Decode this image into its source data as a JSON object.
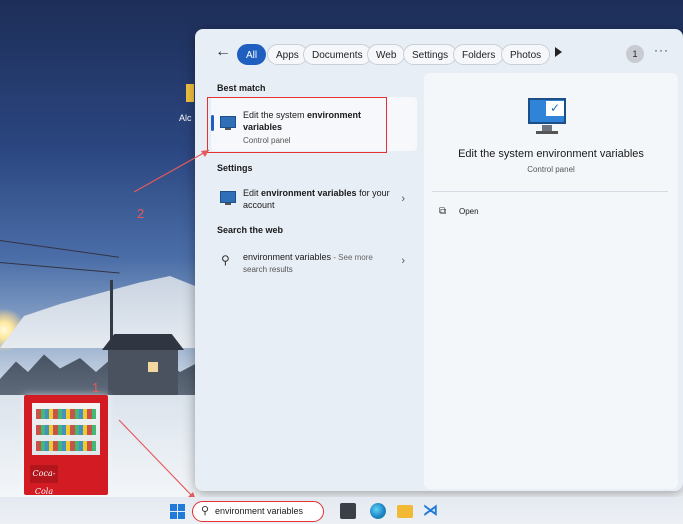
{
  "desktop": {
    "icon_label": "Alc"
  },
  "start_menu": {
    "filters": [
      "All",
      "Apps",
      "Documents",
      "Web",
      "Settings",
      "Folders",
      "Photos"
    ],
    "badge": "1",
    "more": "···",
    "sections": {
      "best_match": "Best match",
      "settings": "Settings",
      "search_web": "Search the web"
    },
    "best_match_result": {
      "title_part1": "Edit the system ",
      "title_bold": "environment variables",
      "subtitle": "Control panel"
    },
    "settings_result": {
      "title_part1": "Edit ",
      "title_bold": "environment variables",
      "title_part2": " for your account"
    },
    "web_result": {
      "title": "environment variables",
      "suffix": " - See more",
      "subtitle": "search results"
    },
    "detail": {
      "title": "Edit the system environment variables",
      "subtitle": "Control panel",
      "action_open": "Open"
    }
  },
  "annotations": {
    "step1": "1",
    "step2": "2",
    "color": "#e23232"
  },
  "taskbar": {
    "search_value": "environment variables"
  },
  "colors": {
    "accent": "#1f5fbf"
  }
}
